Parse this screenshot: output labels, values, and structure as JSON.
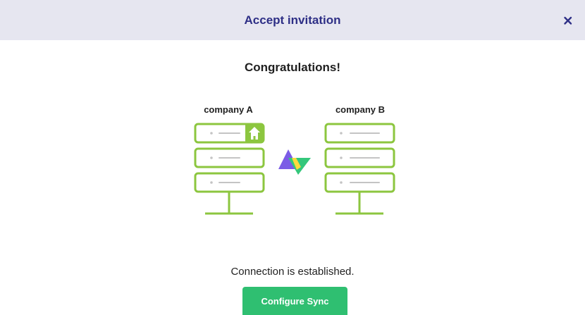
{
  "dialog": {
    "title": "Accept invitation",
    "close_icon": "close-icon"
  },
  "content": {
    "heading": "Congratulations!",
    "company_a_label": "company A",
    "company_b_label": "company B",
    "status": "Connection is established.",
    "configure_button_label": "Configure Sync"
  },
  "icons": {
    "home": "home-icon",
    "logo": "sync-logo-icon",
    "server_a": "server-stack-icon",
    "server_b": "server-stack-icon"
  },
  "colors": {
    "header_bg": "#e6e6f0",
    "title": "#2e2f86",
    "server_green": "#8cc63f",
    "placeholder_gray": "#c4c4c4",
    "button_green": "#2fbf71",
    "logo_purple": "#7b5ce6",
    "logo_green": "#34c77b",
    "logo_yellow": "#ffd93d"
  }
}
